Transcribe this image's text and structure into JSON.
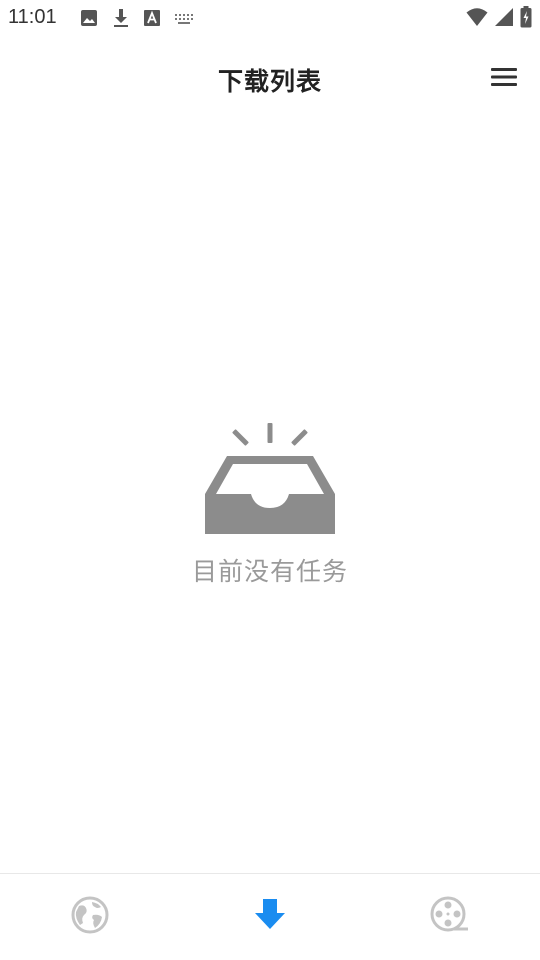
{
  "status_bar": {
    "time": "11:01",
    "left_icons": [
      "image-icon",
      "download-icon",
      "text-a-icon",
      "keyboard-icon"
    ],
    "right_icons": [
      "wifi-icon",
      "signal-icon",
      "battery-icon"
    ]
  },
  "header": {
    "title": "下载列表",
    "menu_icon": "hamburger-menu-icon"
  },
  "empty_state": {
    "icon": "empty-inbox-icon",
    "message": "目前没有任务"
  },
  "bottom_nav": {
    "items": [
      {
        "name": "browser",
        "icon": "globe-icon",
        "active": false
      },
      {
        "name": "downloads",
        "icon": "download-arrow-icon",
        "active": true
      },
      {
        "name": "videos",
        "icon": "film-reel-icon",
        "active": false
      }
    ]
  },
  "colors": {
    "accent": "#1a8cf0",
    "inactive_icon": "#c4c4c4",
    "empty_icon": "#8c8c8c",
    "empty_text": "#9a9a9a",
    "title": "#222222"
  }
}
